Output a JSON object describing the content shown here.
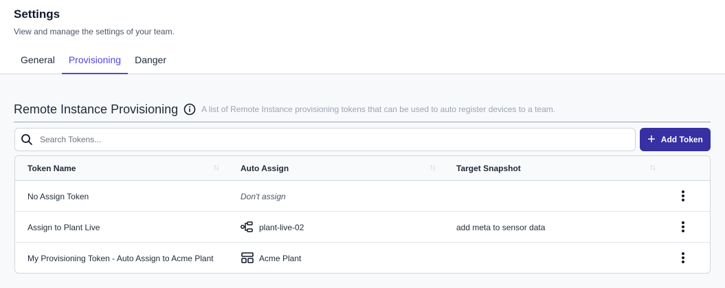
{
  "header": {
    "title": "Settings",
    "subtitle": "View and manage the settings of your team."
  },
  "tabs": [
    {
      "label": "General",
      "active": false
    },
    {
      "label": "Provisioning",
      "active": true
    },
    {
      "label": "Danger",
      "active": false
    }
  ],
  "section": {
    "title": "Remote Instance Provisioning",
    "description": "A list of Remote Instance provisioning tokens that can be used to auto register devices to a team.",
    "info_icon": "info-circle-icon"
  },
  "search": {
    "placeholder": "Search Tokens...",
    "value": ""
  },
  "add_button": {
    "label": "Add Token"
  },
  "table": {
    "columns": [
      "Token Name",
      "Auto Assign",
      "Target Snapshot"
    ],
    "rows": [
      {
        "name": "No Assign Token",
        "auto_assign": "Don't assign",
        "auto_assign_icon": "",
        "target_snapshot": ""
      },
      {
        "name": "Assign to Plant Live",
        "auto_assign": "plant-live-02",
        "auto_assign_icon": "pipeline-icon",
        "target_snapshot": "add meta to sensor data"
      },
      {
        "name": "My Provisioning Token - Auto Assign to Acme Plant",
        "auto_assign": "Acme Plant",
        "auto_assign_icon": "application-icon",
        "target_snapshot": ""
      }
    ]
  },
  "colors": {
    "accent": "#4f46e5",
    "button": "#3730a3"
  }
}
